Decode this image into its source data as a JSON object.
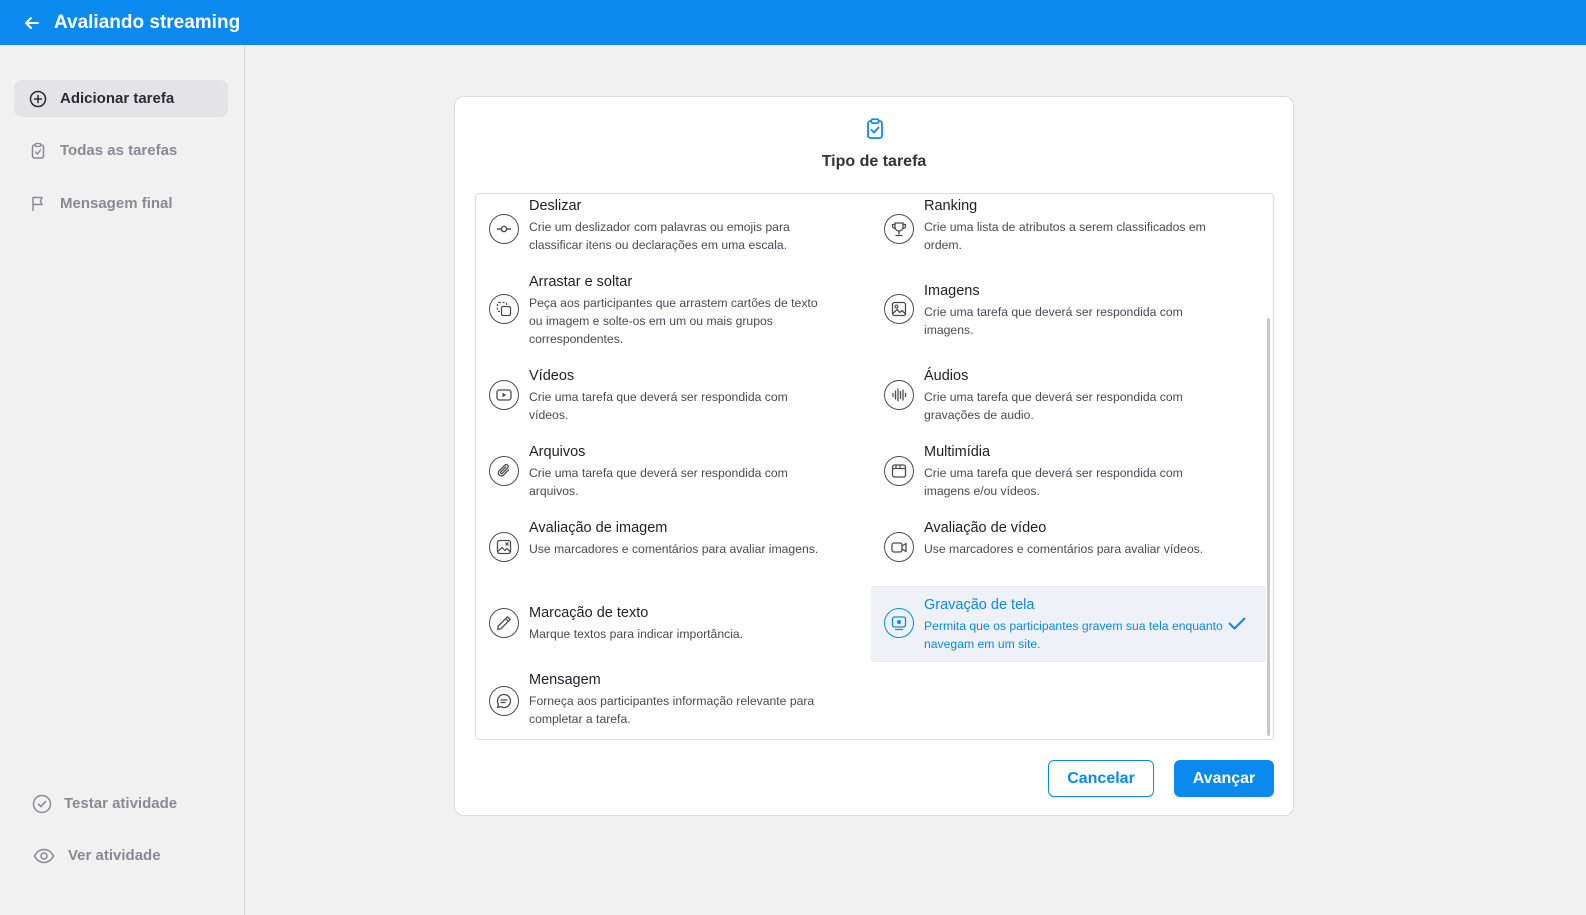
{
  "app": {
    "title": "Avaliando streaming",
    "accent": "#0a8aee"
  },
  "sidebar": {
    "items": [
      {
        "label": "Adicionar tarefa",
        "icon": "plus-circle-icon",
        "active": true
      },
      {
        "label": "Todas as tarefas",
        "icon": "clipboard-icon"
      },
      {
        "label": "Mensagem final",
        "icon": "flag-icon"
      }
    ],
    "bottom": [
      {
        "label": "Testar atividade",
        "icon": "check-circle-icon"
      },
      {
        "label": "Ver atividade",
        "icon": "eye-icon"
      }
    ]
  },
  "modal": {
    "icon": "clipboard-check-icon",
    "title": "Tipo de tarefa",
    "options": [
      {
        "title": "Deslizar",
        "desc": "Crie um deslizador com palavras ou emojis para classificar itens ou declarações em uma escala.",
        "icon": "slider-icon"
      },
      {
        "title": "Ranking",
        "desc": "Crie uma lista de atributos a serem classificados em ordem.",
        "icon": "trophy-icon"
      },
      {
        "title": "Arrastar e soltar",
        "desc": "Peça aos participantes que arrastem cartões de texto ou imagem e solte-os em um ou mais grupos correspondentes.",
        "icon": "drag-drop-icon"
      },
      {
        "title": "Imagens",
        "desc": "Crie uma tarefa que deverá ser respondida com imagens.",
        "icon": "image-icon"
      },
      {
        "title": "Vídeos",
        "desc": "Crie uma tarefa que deverá ser respondida com vídeos.",
        "icon": "video-icon"
      },
      {
        "title": "Áudios",
        "desc": "Crie uma tarefa que deverá ser respondida com gravações de audio.",
        "icon": "audio-wave-icon"
      },
      {
        "title": "Arquivos",
        "desc": "Crie uma tarefa que deverá ser respondida com arquivos.",
        "icon": "paperclip-icon"
      },
      {
        "title": "Multimídia",
        "desc": "Crie uma tarefa que deverá ser respondida com imagens e/ou vídeos.",
        "icon": "multimedia-icon"
      },
      {
        "title": "Avaliação de imagem",
        "desc": "Use marcadores e comentários para avaliar imagens.",
        "icon": "image-review-icon"
      },
      {
        "title": "Avaliação de vídeo",
        "desc": "Use marcadores e comentários para avaliar vídeos.",
        "icon": "video-review-icon"
      },
      {
        "title": "Marcação de texto",
        "desc": "Marque textos para indicar importância.",
        "icon": "pen-icon"
      },
      {
        "title": "Gravação de tela",
        "desc": "Permita que os participantes gravem sua tela enquanto navegam em um site.",
        "icon": "screen-record-icon",
        "selected": true
      },
      {
        "title": "Mensagem",
        "desc": "Forneça aos participantes informação relevante para completar a tarefa.",
        "icon": "message-icon"
      }
    ],
    "cancel_label": "Cancelar",
    "next_label": "Avançar"
  }
}
